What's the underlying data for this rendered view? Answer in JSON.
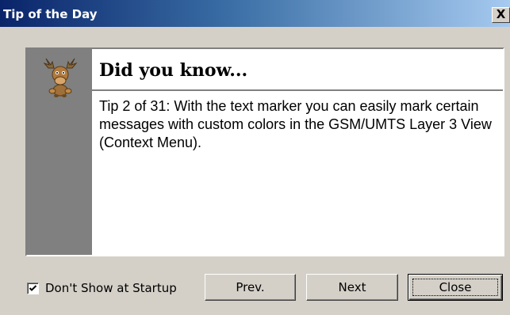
{
  "window": {
    "title": "Tip of the Day",
    "close_glyph": "X"
  },
  "panel": {
    "icon": "moose-icon",
    "heading": "Did you know...",
    "tip_text": "Tip 2 of 31: With the text marker you can easily mark certain messages with custom colors in the GSM/UMTS Layer 3 View (Context Menu)."
  },
  "footer": {
    "checkbox_label": "Don't Show at Startup",
    "checkbox_checked": true,
    "prev_label": "Prev.",
    "next_label": "Next",
    "close_label": "Close"
  },
  "colors": {
    "title_bar_start": "#0a246a",
    "title_bar_end": "#a6caf0",
    "dialog_bg": "#d4d0c8",
    "sidebar": "#808080"
  }
}
